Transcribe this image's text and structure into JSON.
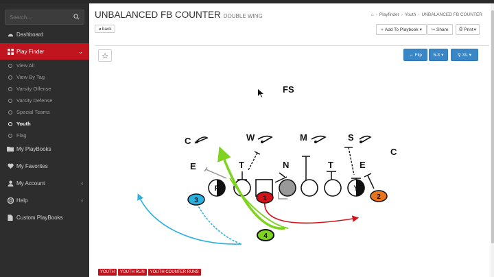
{
  "sidebar": {
    "search_placeholder": "Search...",
    "items": [
      {
        "label": "Dashboard"
      },
      {
        "label": "Play Finder"
      },
      {
        "label": "My PlayBooks"
      },
      {
        "label": "My Favorites"
      },
      {
        "label": "My Account"
      },
      {
        "label": "Help"
      },
      {
        "label": "Custom PlayBooks"
      }
    ],
    "subitems": [
      {
        "label": "View All"
      },
      {
        "label": "View By Tag"
      },
      {
        "label": "Varsity Offense"
      },
      {
        "label": "Varsity Defense"
      },
      {
        "label": "Special Teams"
      },
      {
        "label": "Youth"
      },
      {
        "label": "Flag"
      }
    ]
  },
  "header": {
    "title": "UNBALANCED FB COUNTER",
    "subtitle": "DOUBLE WING",
    "breadcrumb": [
      "Playfinder",
      "Youth",
      "UNBALANCED FB COUNTER"
    ],
    "back_label": "back",
    "add_label": "Add To Playbook",
    "share_label": "Share",
    "print_label": "Print"
  },
  "toolbar": {
    "flip_label": "Flip",
    "front_label": "5-3",
    "zoom_label": "XL"
  },
  "diagram": {
    "defense": [
      "FS",
      "C",
      "W",
      "M",
      "S",
      "C",
      "E",
      "T",
      "N",
      "T",
      "E"
    ],
    "offense": [
      "F",
      "Y",
      "1",
      "2",
      "3",
      "4"
    ],
    "colors": {
      "red": "#d4121a",
      "orange": "#e8741e",
      "blue": "#2bb0e0",
      "green": "#7ed321"
    }
  },
  "tags": [
    "YOUTH",
    "YOUTH RUN",
    "YOUTH COUNTER RUNS"
  ]
}
